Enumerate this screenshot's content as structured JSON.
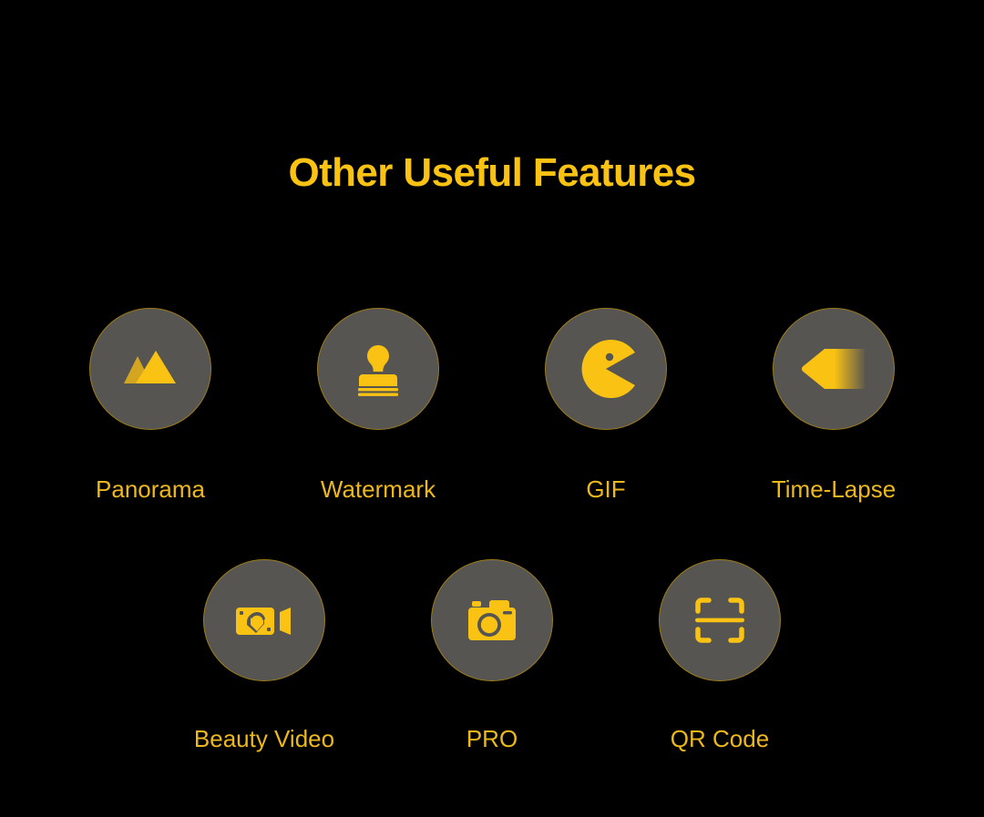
{
  "page": {
    "title": "Other Useful Features",
    "background_color": "#000000",
    "title_color": "#FAC213",
    "label_color": "#EDB81C",
    "circle_fill_color": "#565552",
    "circle_border_color": "#9C7C1A",
    "icon_color": "#FAC213"
  },
  "features": {
    "row1": [
      {
        "label": "Panorama",
        "icon": "mountains-icon"
      },
      {
        "label": "Watermark",
        "icon": "stamp-icon"
      },
      {
        "label": "GIF",
        "icon": "pacman-icon"
      },
      {
        "label": "Time-Lapse",
        "icon": "fast-rewind-arrow-icon"
      }
    ],
    "row2": [
      {
        "label": "Beauty Video",
        "icon": "video-camera-face-icon"
      },
      {
        "label": "PRO",
        "icon": "camera-icon"
      },
      {
        "label": "QR Code",
        "icon": "qr-scan-frame-icon"
      }
    ]
  }
}
